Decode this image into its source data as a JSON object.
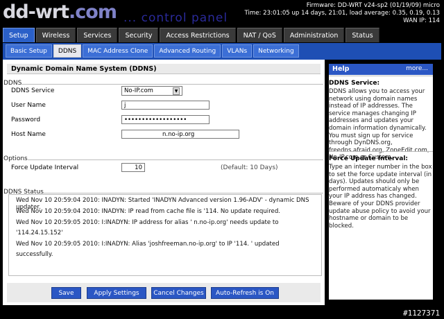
{
  "header": {
    "logo_text": "dd-wrt",
    "logo_dot": ".com",
    "tagline": "... control panel",
    "firmware": "Firmware: DD-WRT v24-sp2 (01/19/09) micro",
    "time": "Time: 23:01:05 up 14 days, 21:01, load average: 0.35, 0.19, 0.13",
    "wan_ip": "WAN IP: 114"
  },
  "main_tabs": [
    "Setup",
    "Wireless",
    "Services",
    "Security",
    "Access Restrictions",
    "NAT / QoS",
    "Administration",
    "Status"
  ],
  "sub_tabs": [
    "Basic Setup",
    "DDNS",
    "MAC Address Clone",
    "Advanced Routing",
    "VLANs",
    "Networking"
  ],
  "section_title": "Dynamic Domain Name System (DDNS)",
  "ddns": {
    "legend": "DDNS",
    "service_label": "DDNS Service",
    "service_value": "No-IP.com",
    "username_label": "User Name",
    "username_value": "j",
    "password_label": "Password",
    "password_value": "••••••••••••••••••",
    "hostname_label": "Host Name",
    "hostname_value": "n.no-ip.org"
  },
  "options": {
    "legend": "Options",
    "force_label": "Force Update Interval",
    "force_value": "10",
    "force_default": "(Default: 10 Days)"
  },
  "status": {
    "legend": "DDNS Status",
    "lines": [
      "Wed Nov 10 20:59:04 2010: INADYN: Started 'INADYN Advanced version 1.96-ADV' - dynamic DNS updater.",
      "Wed Nov 10 20:59:04 2010: INADYN: IP read from cache file is '114.          No update required.",
      "Wed Nov 10 20:59:05 2010: I:INADYN: IP address for alias '          n.no-ip.org' needs update to",
      "'114.24.15.152'",
      "Wed Nov 10 20:59:05 2010: I:INADYN: Alias 'joshfreeman.no-ip.org' to IP '114.           ' updated",
      "successfully."
    ]
  },
  "buttons": {
    "save": "Save",
    "apply": "Apply Settings",
    "cancel": "Cancel Changes",
    "refresh": "Auto-Refresh is On"
  },
  "help": {
    "title": "Help",
    "more": "more...",
    "h1": "DDNS Service:",
    "p1": "DDNS allows you to access your network using domain names instead of IP addresses. The service manages changing IP addresses and updates your domain information dynamically. You must sign up for service through DynDNS.org, freedns.afraid.org, ZoneEdit.com, No-IP.com or Custom.",
    "h2": "Force Update Interval:",
    "p2": "Type an integer number in the box to set the force update interval (in days). Updates should only be performed automaticaly when your IP address has changed. Beware of your DDNS provider update abuse policy to avoid your hostname or domain to be blocked."
  },
  "watermark": "#1127371"
}
